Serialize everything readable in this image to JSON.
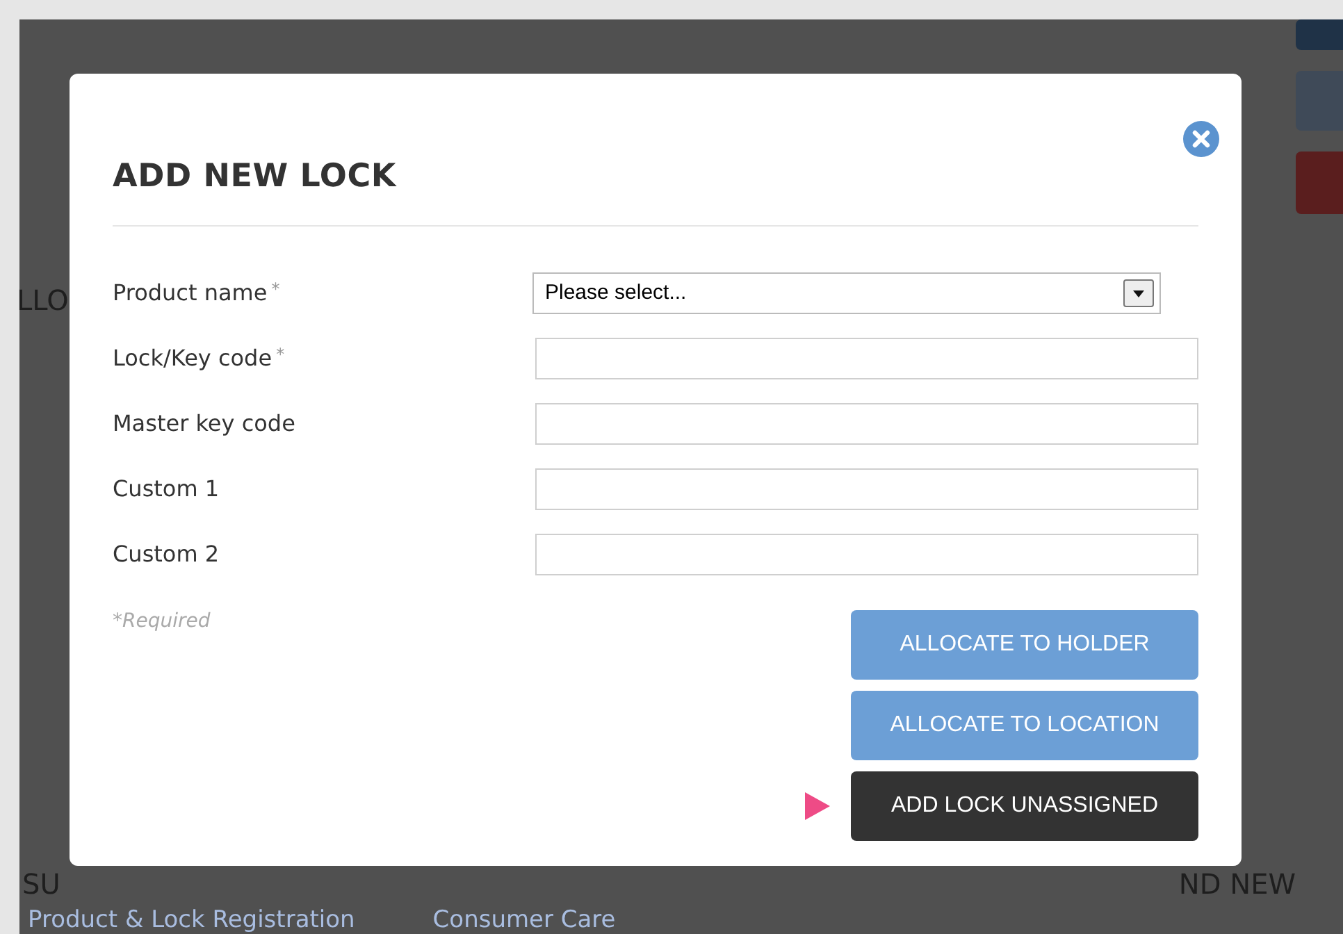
{
  "background": {
    "left_heading": "LLO",
    "footer_headings": [
      "SU",
      "ND NEW"
    ],
    "footer_links": [
      "Product & Lock Registration",
      "Consumer Care"
    ]
  },
  "dialog": {
    "title": "ADD NEW LOCK",
    "fields": [
      {
        "kind": "select",
        "label": "Product name",
        "required_mark": "*",
        "value": "Please select..."
      },
      {
        "kind": "text",
        "label": "Lock/Key code",
        "required_mark": "*"
      },
      {
        "kind": "text",
        "label": "Master key code"
      },
      {
        "kind": "text",
        "label": "Custom 1"
      },
      {
        "kind": "text",
        "label": "Custom 2"
      }
    ],
    "required_note": "*Required",
    "buttons": [
      {
        "label": "ALLOCATE TO HOLDER",
        "kind": "light",
        "pointed": false
      },
      {
        "label": "ALLOCATE TO LOCATION",
        "kind": "light",
        "pointed": false
      },
      {
        "label": "ADD LOCK UNASSIGNED",
        "kind": "dark",
        "pointed": true
      }
    ]
  }
}
